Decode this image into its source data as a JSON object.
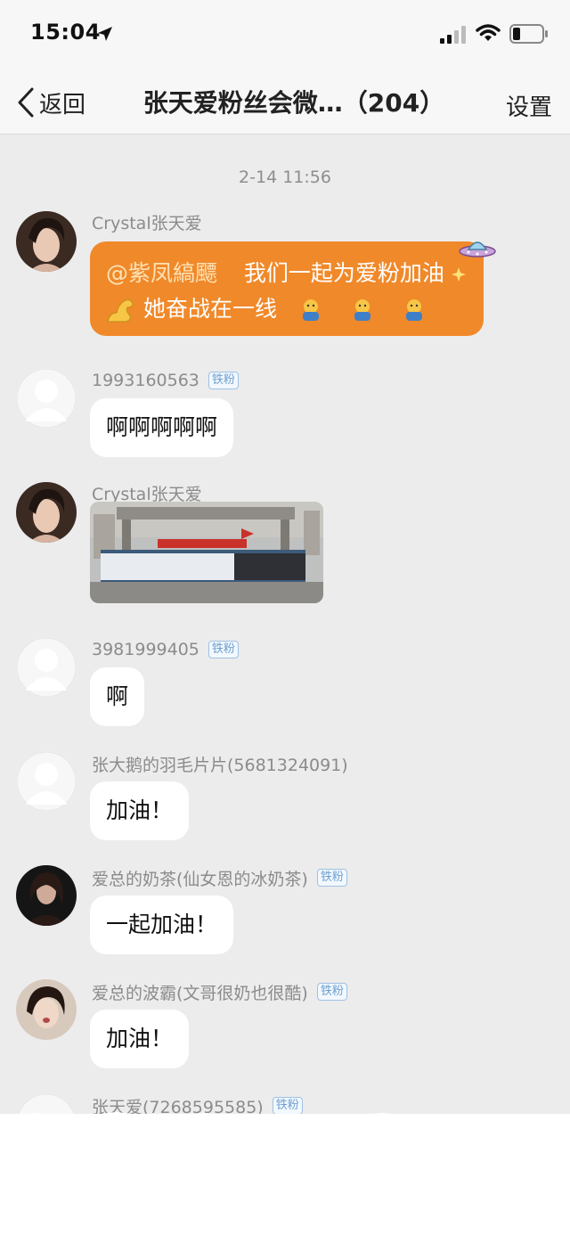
{
  "status_bar": {
    "time": "15:04",
    "signal_icon": "cellular-signal-icon",
    "wifi_icon": "wifi-icon",
    "battery_icon": "battery-icon",
    "location_icon": "location-arrow-icon"
  },
  "nav": {
    "back_label": "返回",
    "title": "张天爱粉丝会微…（204）",
    "settings_label": "设置"
  },
  "chat": {
    "timestamp": "2-14 11:56",
    "messages": [
      {
        "sender": "Crystal张天爱",
        "mention": "@紫凤縞飃",
        "text_line1": "我们一起为爱粉加油",
        "text_line2": "她奋战在一线"
      },
      {
        "sender": "1993160563",
        "badge": "铁粉",
        "text": "啊啊啊啊啊"
      },
      {
        "sender": "Crystal张天爱"
      },
      {
        "sender": "3981999405",
        "badge": "铁粉",
        "text": "啊"
      },
      {
        "sender": "张大鹅的羽毛片片(5681324091)",
        "text": "加油！"
      },
      {
        "sender": "爱总的奶茶(仙女恩的冰奶茶)",
        "badge": "铁粉",
        "text": "一起加油！"
      },
      {
        "sender": "爱总的波霸(文哥很奶也很酷)",
        "badge": "铁粉",
        "text": "加油！"
      },
      {
        "sender": "张天爱(7268595585)",
        "badge": "铁粉"
      }
    ]
  },
  "colors": {
    "orange_bubble": "#f0892a",
    "mention_text": "#fde2b5",
    "badge_blue": "#6fa0d0",
    "background": "#ececec"
  }
}
